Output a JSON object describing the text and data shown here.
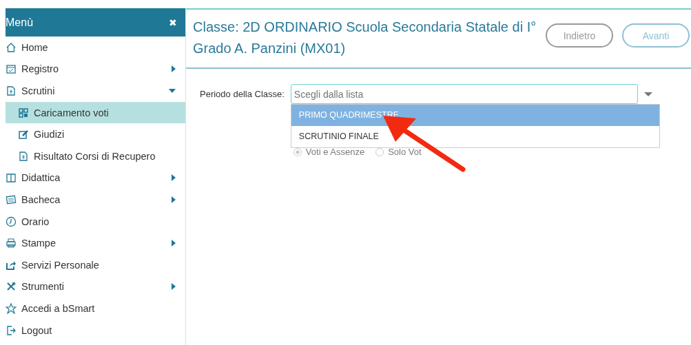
{
  "sidebar": {
    "title": "Menù",
    "close": "✖",
    "items": [
      {
        "label": "Home",
        "selected": false
      },
      {
        "label": "Registro",
        "expanded": false,
        "selected": false
      },
      {
        "label": "Scrutini",
        "expanded": true,
        "selected": false,
        "children": [
          {
            "label": "Caricamento voti",
            "selected": true
          },
          {
            "label": "Giudizi",
            "selected": false
          },
          {
            "label": "Risultato Corsi di Recupero",
            "selected": false
          }
        ]
      },
      {
        "label": "Didattica",
        "expanded": false,
        "selected": false
      },
      {
        "label": "Bacheca",
        "expanded": false,
        "selected": false
      },
      {
        "label": "Orario",
        "selected": false
      },
      {
        "label": "Stampe",
        "expanded": false,
        "selected": false
      },
      {
        "label": "Servizi Personale",
        "selected": false
      },
      {
        "label": "Strumenti",
        "expanded": false,
        "selected": false
      },
      {
        "label": "Accedi a bSmart",
        "selected": false
      },
      {
        "label": "Logout",
        "selected": false
      }
    ]
  },
  "header": {
    "title": "Classe: 2D ORDINARIO Scuola Secondaria Statale di I° Grado A. Panzini (MX01)",
    "buttons": [
      {
        "label": "Indietro",
        "kind": "back"
      },
      {
        "label": "Avanti",
        "kind": "next"
      }
    ]
  },
  "form": {
    "label": "Periodo della Classe:",
    "placeholder": "Scegli dalla lista",
    "options": [
      {
        "label": "PRIMO QUADRIMESTRE",
        "selected": true
      },
      {
        "label": "SCRUTINIO FINALE",
        "selected": false
      }
    ],
    "radios": [
      {
        "label": "Voti e Assenze",
        "selected": true
      },
      {
        "label": "Solo Vot",
        "selected": false
      }
    ]
  }
}
